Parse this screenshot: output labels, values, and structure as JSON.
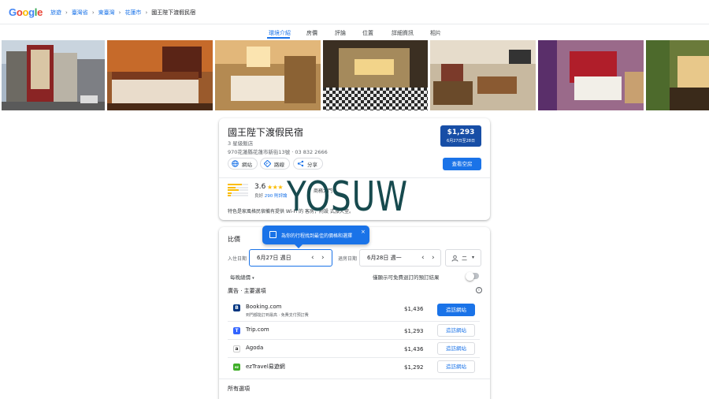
{
  "header": {
    "logo": "Google",
    "breadcrumb": [
      "旅遊",
      "臺灣省",
      "東臺灣",
      "花蓮市",
      "國王陛下渡假民宿"
    ]
  },
  "tabs": [
    "環境介紹",
    "房價",
    "評論",
    "位置",
    "詳細資訊",
    "相片"
  ],
  "hotel": {
    "name": "國王陛下渡假民宿",
    "stars": "3 星級飯店",
    "address": "970花蓮縣花蓮市新街13號 · 03 832 2666",
    "price": "$1,293",
    "dates": "6月27日至28日",
    "website_label": "網站",
    "directions_label": "路線",
    "share_label": "分享",
    "check_rooms_label": "查看空房",
    "rating": "3.6",
    "rating_stars": "★★★",
    "rating_word": "良好",
    "reviews": "290 則評論",
    "facility": "商務大門",
    "description": "特色是家風格民宿備有提供 Wi-Fi 的    客房，附設    式旅大堂。"
  },
  "watermark": "YOSUW",
  "prices": {
    "section_title": "比價",
    "tooltip": "為你的行程找到最佳的價格和選擇",
    "checkin_label": "入住日期",
    "checkin_value": "6月27日 週日",
    "checkout_label": "退房日期",
    "checkout_value": "6月28日 週一",
    "guests_value": "二",
    "nightly_label": "每晚總價",
    "free_cancel_label": "僅顯示可免費退訂的預訂結果",
    "ads_title": "廣告 · 主要選項",
    "providers": [
      {
        "name": "Booking.com",
        "sub": "到門都能訂到最高 · 免費支付預訂費",
        "price": "$1,436",
        "btn": "造訪網站",
        "color": "#003580",
        "letter": "B"
      },
      {
        "name": "Trip.com",
        "sub": "",
        "price": "$1,293",
        "btn": "造訪網站",
        "color": "#3264ff",
        "letter": "T"
      },
      {
        "name": "Agoda",
        "sub": "",
        "price": "$1,436",
        "btn": "造訪網站",
        "color": "#ffffff",
        "letter": "a"
      },
      {
        "name": "ezTravel易遊網",
        "sub": "",
        "price": "$1,292",
        "btn": "造訪網站",
        "color": "#3fae29",
        "letter": "ez"
      }
    ],
    "all_options": "所有選項"
  },
  "colors": {
    "accent": "#1a73e8",
    "price_box": "#174ea6",
    "watermark": "#174a4e"
  }
}
